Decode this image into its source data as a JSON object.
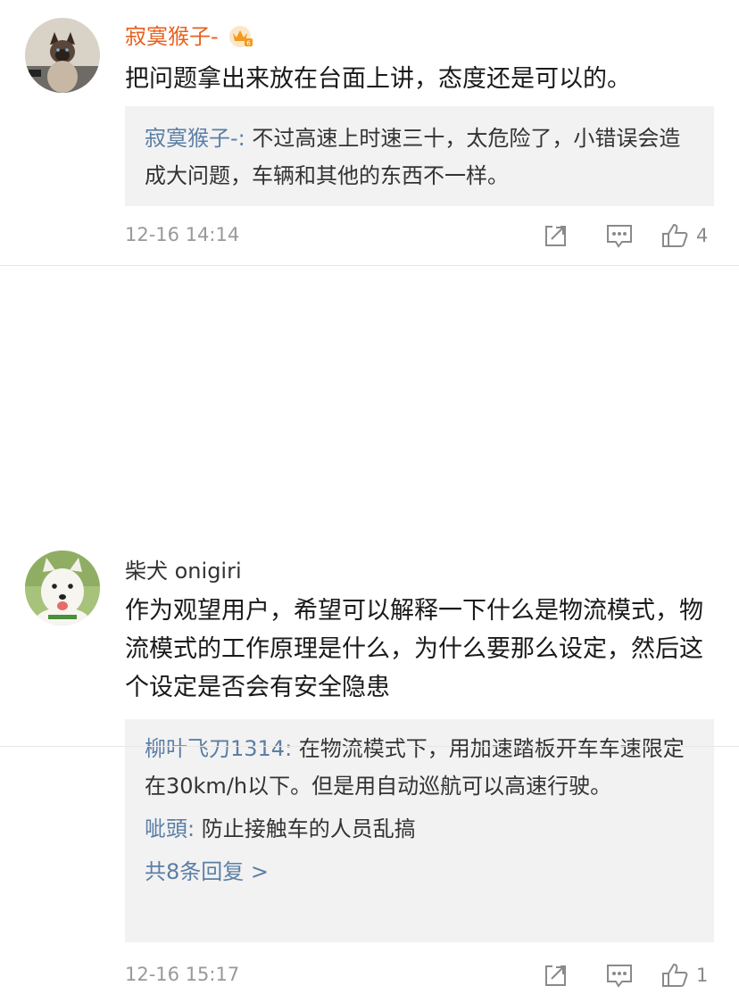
{
  "comments": [
    {
      "author": "寂寞猴子-",
      "text": "把问题拿出来放在台面上讲，态度还是可以的。",
      "replies": [
        {
          "author": "寂寞猴子-:",
          "text": " 不过高速上时速三十，太危险了，小错误会造成大问题，车辆和其他的东西不一样。"
        }
      ],
      "time": "12-16 14:14",
      "likes": "4"
    },
    {
      "author": "柴犬 onigiri",
      "text": "作为观望用户，希望可以解释一下什么是物流模式，物流模式的工作原理是什么，为什么要那么设定，然后这个设定是否会有安全隐患",
      "replies": [
        {
          "author": "柳叶飞刀1314:",
          "text": " 在物流模式下，用加速踏板开车车速限定在30km/h以下。但是用自动巡航可以高速行驶。"
        },
        {
          "author": "呲頭:",
          "text": " 防止接触车的人员乱搞"
        }
      ],
      "more_replies": "共8条回复 >",
      "time": "12-16 15:17",
      "likes": "1"
    }
  ],
  "colors": {
    "vip_author": "#e8601d",
    "reply_author": "#5b7ea6",
    "reply_bg": "#f2f2f2",
    "meta": "#999999"
  },
  "icons": [
    "share-icon",
    "comment-icon",
    "like-icon",
    "vip-crown-icon"
  ]
}
